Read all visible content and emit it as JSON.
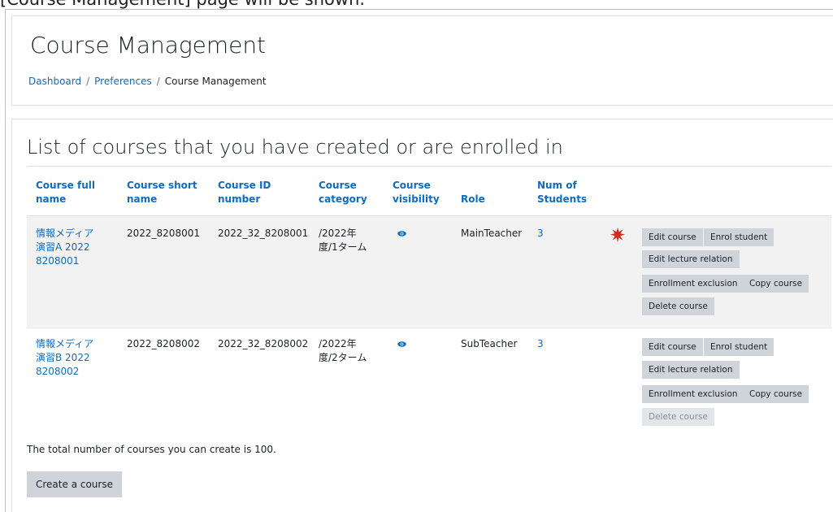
{
  "caption": "[Course Management] page will be shown.",
  "header": {
    "title": "Course Management",
    "breadcrumb": [
      {
        "label": "Dashboard"
      },
      {
        "label": "Preferences"
      },
      {
        "label": "Course Management"
      }
    ]
  },
  "section_title": "List of courses that you have created or are enrolled in",
  "columns": [
    {
      "line1": "Course full",
      "line2": "name"
    },
    {
      "line1": "Course short",
      "line2": "name"
    },
    {
      "line1": "Course ID",
      "line2": "number"
    },
    {
      "line1": "Course",
      "line2": "category"
    },
    {
      "line1": "Course",
      "line2": "visibility"
    },
    {
      "line1": "Role",
      "line2": ""
    },
    {
      "line1": "Num of",
      "line2": "Students"
    }
  ],
  "rows": [
    {
      "full_name": [
        "情報メディア",
        "演習A 2022",
        "8208001"
      ],
      "short_name": "2022_8208001",
      "id_number": "2022_32_8208001",
      "category": [
        "/2022年",
        "度/1ターム"
      ],
      "visibility_icon": "eye-icon",
      "role": "MainTeacher",
      "students": "3",
      "highlighted": true,
      "marker_icon": "red-star-icon",
      "actions": {
        "edit": "Edit course",
        "enrol": "Enrol student",
        "lecture": "Edit lecture relation",
        "exclusion": "Enrollment exclusion",
        "copy": "Copy course",
        "delete": "Delete course"
      }
    },
    {
      "full_name": [
        "情報メディア",
        "演習B 2022",
        "8208002"
      ],
      "short_name": "2022_8208002",
      "id_number": "2022_32_8208002",
      "category": [
        "/2022年",
        "度/2ターム"
      ],
      "visibility_icon": "eye-icon",
      "role": "SubTeacher",
      "students": "3",
      "highlighted": false,
      "actions": {
        "edit": "Edit course",
        "enrol": "Enrol student",
        "lecture": "Edit lecture relation",
        "exclusion": "Enrollment exclusion",
        "copy": "Copy course",
        "delete": "Delete course",
        "delete_disabled": true
      }
    }
  ],
  "footer_note": "The total number of courses you can create is 100.",
  "create_button": "Create a course",
  "colors": {
    "link": "#0f6cbf",
    "button": "#ced4da",
    "row_highlight": "#f2f2f2",
    "star": "#d42a1e"
  }
}
